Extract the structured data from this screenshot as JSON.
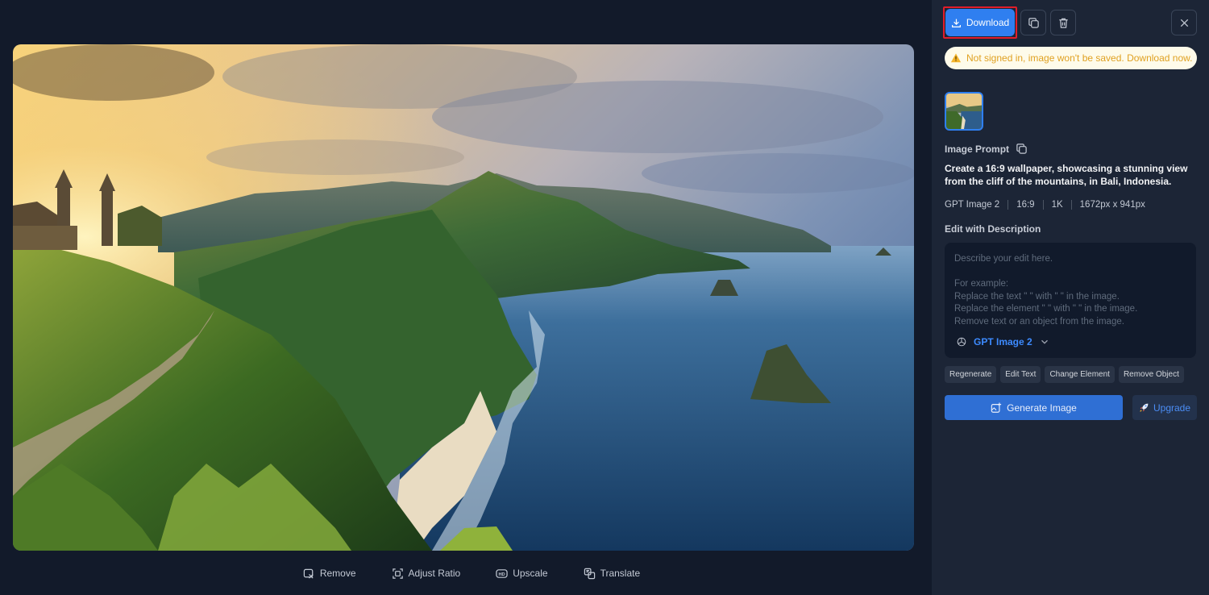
{
  "toolbar": {
    "download_label": "Download",
    "copy_icon": "copy-icon",
    "delete_icon": "trash-icon",
    "close_icon": "close-icon"
  },
  "warning": {
    "text": "Not signed in, image won't be saved. Download now.",
    "icon": "warning-triangle-icon"
  },
  "prompt": {
    "label": "Image Prompt",
    "text": "Create a 16:9 wallpaper, showcasing a stunning view from the cliff of the mountains, in Bali, Indonesia."
  },
  "meta": {
    "model": "GPT Image 2",
    "ratio": "16:9",
    "quality": "1K",
    "size": "1672px x 941px"
  },
  "edit": {
    "label": "Edit with Description",
    "placeholder_line1": "Describe your edit here.",
    "placeholder_line2": "For example:",
    "placeholder_line3": "Replace the text \"      \" with \"      \" in the image.",
    "placeholder_line4": "Replace the element \"      \" with \"      \" in the image.",
    "placeholder_line5": "Remove text or an object from the image.",
    "model_label": "GPT Image 2"
  },
  "chips": [
    "Regenerate",
    "Edit Text",
    "Change Element",
    "Remove Object"
  ],
  "actions": {
    "generate_label": "Generate Image",
    "upgrade_label": "Upgrade"
  },
  "bottom_tools": {
    "remove": "Remove",
    "adjust_ratio": "Adjust Ratio",
    "upscale": "Upscale",
    "translate": "Translate"
  },
  "colors": {
    "accent": "#2f7ff0",
    "panel_bg": "#1c2536",
    "canvas_bg": "#121a2a",
    "warning_text": "#e0a122",
    "highlight_border": "#e11d2a"
  }
}
